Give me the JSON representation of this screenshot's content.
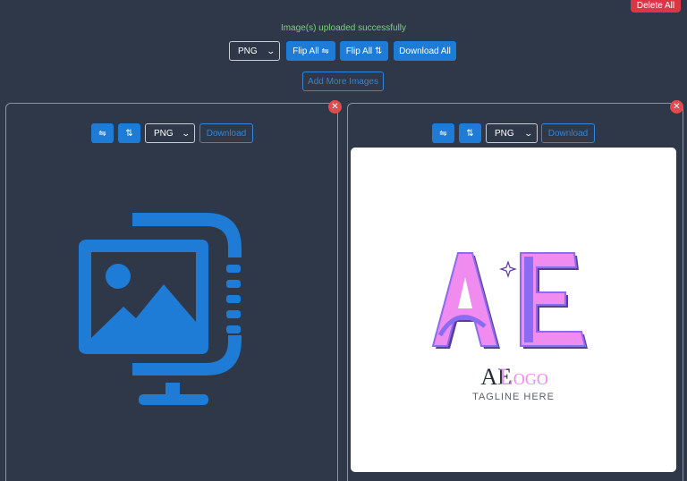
{
  "header": {
    "delete_all_label": "Delete All",
    "status_message": "Image(s) uploaded successfully",
    "format_value": "PNG",
    "flip_all_h_label": "Flip All ⇋",
    "flip_all_v_label": "Flip All ⇅",
    "download_all_label": "Download All",
    "add_more_label": "Add More Images"
  },
  "cards": [
    {
      "close_label": "✕",
      "flip_h_label": "⇋",
      "flip_v_label": "⇅",
      "format_value": "PNG",
      "download_label": "Download",
      "image": "image-placeholder-icon"
    },
    {
      "close_label": "✕",
      "flip_h_label": "⇋",
      "flip_v_label": "⇅",
      "format_value": "PNG",
      "download_label": "Download",
      "image": {
        "logo_letters": "AE",
        "logo_word_1": "AE",
        "logo_word_2": "Logo",
        "tagline": "TAGLINE HERE"
      }
    }
  ],
  "colors": {
    "background": "#2e3848",
    "accent_blue": "#1e7bd6",
    "danger_red": "#dc3545",
    "success_green": "#7ed07a",
    "logo_pink": "#f08cf0",
    "logo_purple": "#8a6cf2",
    "logo_dark": "#252b3b"
  },
  "icons": [
    "flip-horizontal-icon",
    "flip-vertical-icon",
    "close-icon",
    "chevron-down-icon",
    "image-placeholder-icon",
    "sparkle-icon"
  ]
}
